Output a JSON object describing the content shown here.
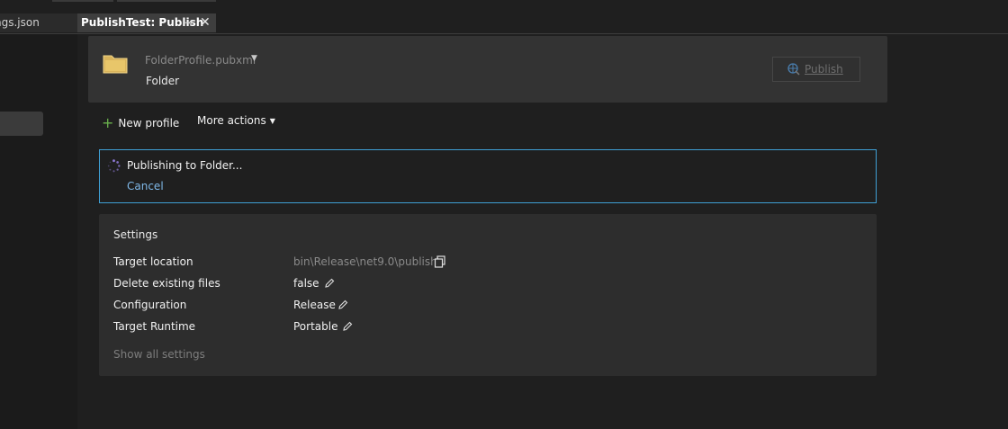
{
  "tabs": {
    "inactive_label": "ngs.json",
    "active_label": "PublishTest: Publish",
    "pin_glyph": "⊸",
    "close_glyph": "✕"
  },
  "profile": {
    "file_name": "FolderProfile.pubxml",
    "type": "Folder",
    "publish_label": "Publish"
  },
  "actions": {
    "new_profile": "New profile",
    "more_actions": "More actions"
  },
  "progress": {
    "status": "Publishing to Folder...",
    "cancel": "Cancel"
  },
  "settings": {
    "title": "Settings",
    "rows": [
      {
        "label": "Target location",
        "value": "bin\\Release\\net9.0\\publish\\"
      },
      {
        "label": "Delete existing files",
        "value": "false"
      },
      {
        "label": "Configuration",
        "value": "Release"
      },
      {
        "label": "Target Runtime",
        "value": "Portable"
      }
    ],
    "show_all": "Show all settings"
  },
  "colors": {
    "accent_blue": "#3f9fd4",
    "link_blue": "#7fb8e8",
    "plus_green": "#6ab04c",
    "folder_yellow": "#e8c66a"
  }
}
